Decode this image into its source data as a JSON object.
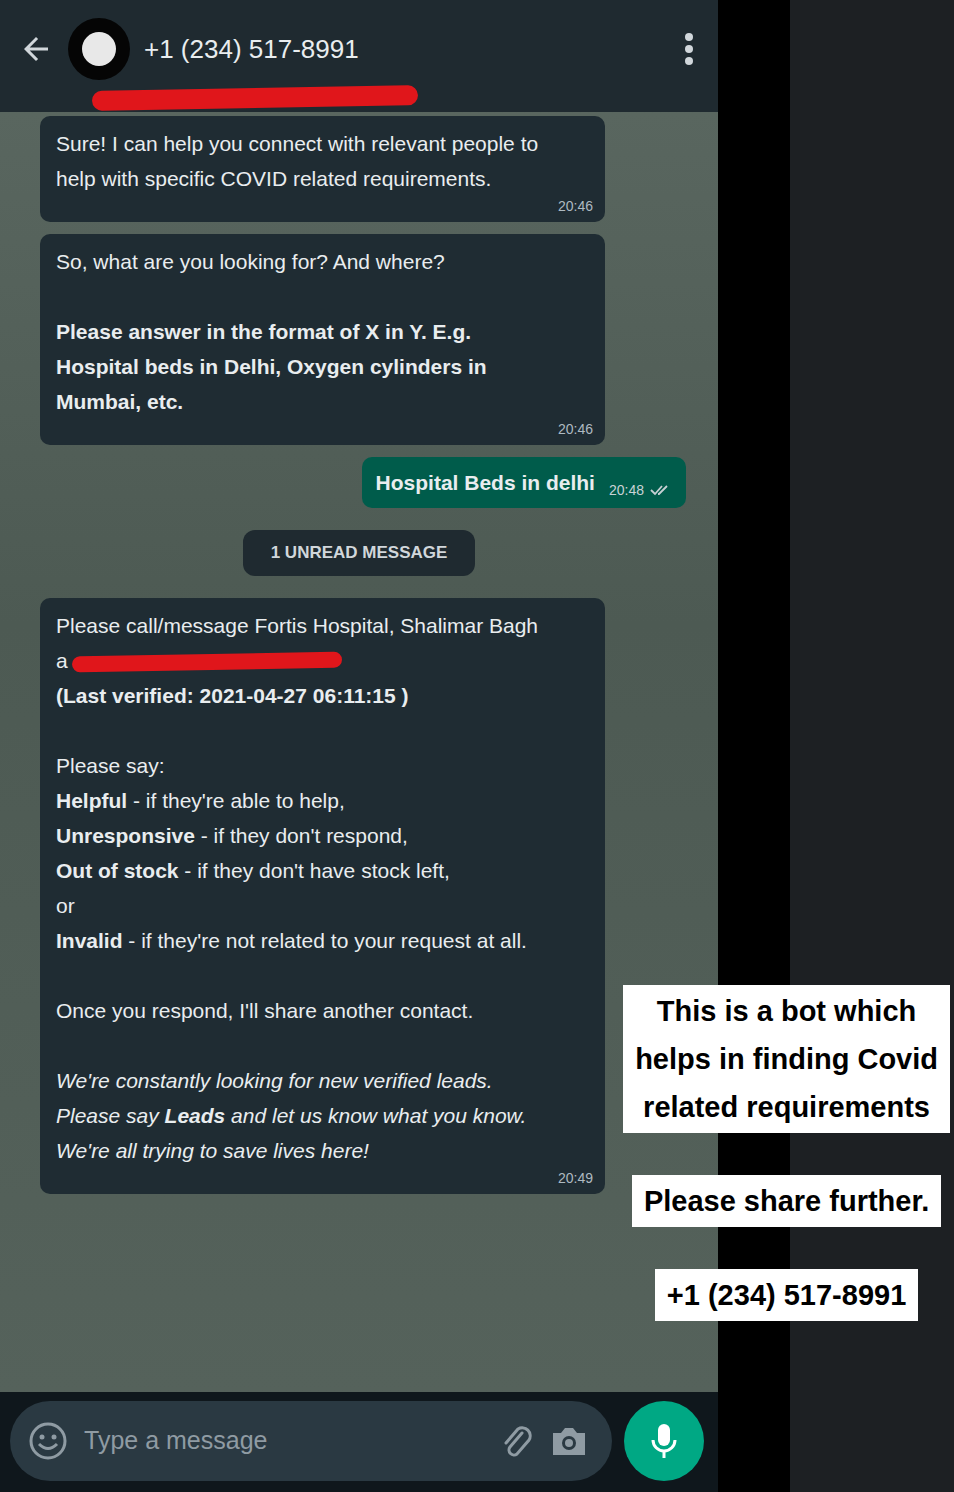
{
  "header": {
    "title": "+1 (234) 517-8991",
    "redacted": true
  },
  "messages": [
    {
      "kind": "bubble",
      "direction": "in",
      "time": "20:46",
      "read": false,
      "blocks": [
        [
          [
            {
              "text": "Sure! I can help you connect with relevant people to help with specific COVID related requirements.",
              "bold": false,
              "italic": false,
              "redacted": false
            }
          ]
        ]
      ]
    },
    {
      "kind": "bubble",
      "direction": "in",
      "time": "20:46",
      "read": false,
      "blocks": [
        [
          [
            {
              "text": "So, what are you looking for? And where?",
              "bold": false,
              "italic": false,
              "redacted": false
            }
          ]
        ],
        [
          [
            {
              "text": "Please answer in the format of X in Y. E.g. Hospital beds in Delhi, Oxygen cylinders in Mumbai, etc.",
              "bold": true,
              "italic": false,
              "redacted": false
            }
          ]
        ]
      ]
    },
    {
      "kind": "bubble",
      "direction": "out",
      "time": "20:48",
      "read": false,
      "blocks": [
        [
          [
            {
              "text": "Hospital Beds in delhi",
              "bold": true,
              "italic": false,
              "redacted": false
            }
          ]
        ]
      ]
    },
    {
      "kind": "divider",
      "text": "1 UNREAD MESSAGE"
    },
    {
      "kind": "bubble",
      "direction": "in",
      "time": "20:49",
      "read": false,
      "blocks": [
        [
          [
            {
              "text": "Please call/message Fortis Hospital, Shalimar Bagh a",
              "bold": false,
              "italic": false,
              "redacted": true
            }
          ],
          [
            {
              "text": "(Last verified: 2021-04-27 06:11:15 )",
              "bold": true,
              "italic": false,
              "redacted": false
            }
          ]
        ],
        [
          [
            {
              "text": "Please say:",
              "bold": false,
              "italic": false,
              "redacted": false
            }
          ],
          [
            {
              "text": "Helpful",
              "bold": true,
              "italic": false,
              "redacted": false
            },
            {
              "text": " - if they're able to help,",
              "bold": false,
              "italic": false,
              "redacted": false
            }
          ],
          [
            {
              "text": "Unresponsive",
              "bold": true,
              "italic": false,
              "redacted": false
            },
            {
              "text": " - if they don't respond,",
              "bold": false,
              "italic": false,
              "redacted": false
            }
          ],
          [
            {
              "text": "Out of stock",
              "bold": true,
              "italic": false,
              "redacted": false
            },
            {
              "text": " - if they don't have stock left,",
              "bold": false,
              "italic": false,
              "redacted": false
            }
          ],
          [
            {
              "text": "or",
              "bold": false,
              "italic": false,
              "redacted": false
            }
          ],
          [
            {
              "text": "Invalid",
              "bold": true,
              "italic": false,
              "redacted": false
            },
            {
              "text": " - if they're not related to your request at all.",
              "bold": false,
              "italic": false,
              "redacted": false
            }
          ]
        ],
        [
          [
            {
              "text": "Once you respond, I'll share another contact.",
              "bold": false,
              "italic": false,
              "redacted": false
            }
          ]
        ],
        [
          [
            {
              "text": "We're constantly looking for new verified leads. Please say ",
              "bold": false,
              "italic": true,
              "redacted": false
            },
            {
              "text": "Leads",
              "bold": true,
              "italic": true,
              "redacted": false
            },
            {
              "text": " and let us know what you know. We're all trying to save lives here!",
              "bold": false,
              "italic": true,
              "redacted": false
            }
          ]
        ]
      ]
    }
  ],
  "composer": {
    "placeholder": "Type a message"
  },
  "overlay": [
    {
      "lines": [
        "This is a bot which",
        "helps in finding Covid",
        "related requirements"
      ]
    },
    {
      "lines": [
        "Please share further."
      ]
    },
    {
      "lines": [
        "+1 (234) 517-8991"
      ]
    }
  ]
}
